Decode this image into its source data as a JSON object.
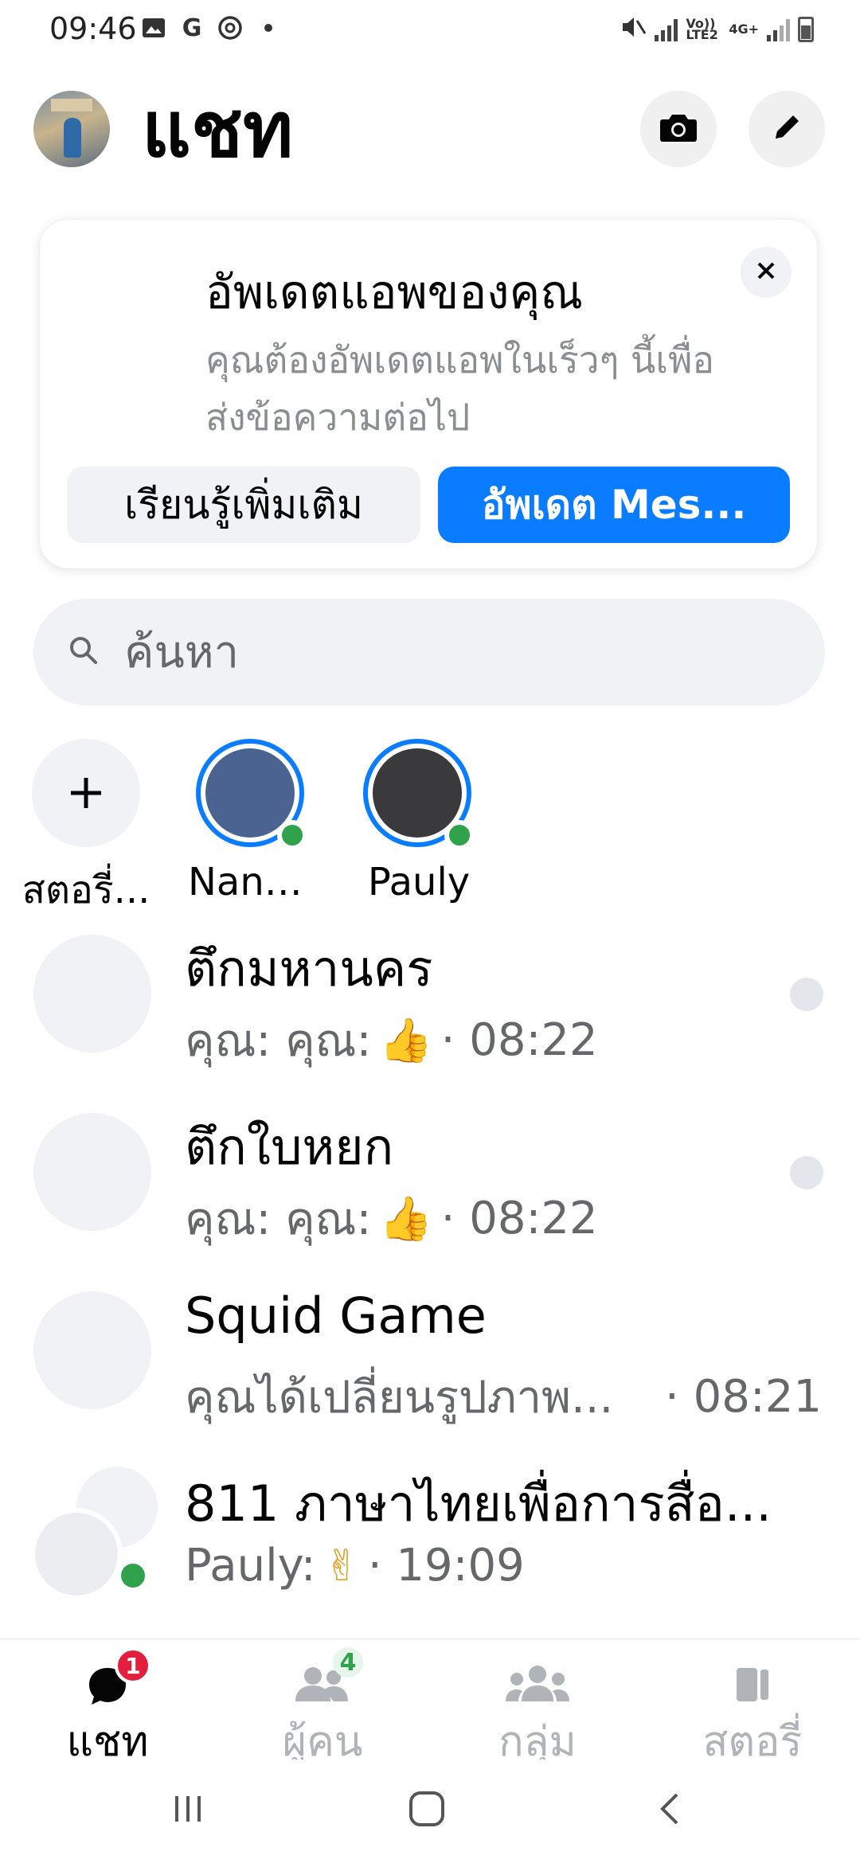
{
  "status_bar": {
    "time": "09:46",
    "left_icons": [
      "image-icon",
      "google-icon",
      "threads-icon",
      "dot-icon"
    ],
    "network_label_1": "Vo)) LTE2",
    "network_label_2": "4G+"
  },
  "header": {
    "title": "แชท",
    "camera_icon": "camera-icon",
    "compose_icon": "pencil-icon"
  },
  "update_card": {
    "title": "อัพเดตแอพของคุณ",
    "description": "คุณต้องอัพเดตแอพในเร็วๆ นี้เพื่อส่งข้อความต่อไป",
    "learn_more_label": "เรียนรู้เพิ่มเติม",
    "update_label": "อัพเดต Mes...",
    "close_icon": "close-icon"
  },
  "search": {
    "placeholder": "ค้นหา"
  },
  "stories": {
    "add_label": "สตอรี่...",
    "items": [
      {
        "name": "Nanti...",
        "color": "#4a6391",
        "online": true
      },
      {
        "name": "Pauly",
        "color": "#3a393c",
        "online": true
      }
    ]
  },
  "chats": [
    {
      "name": "ตึกมหานคร",
      "preview": "คุณ: คุณ:",
      "emoji": "👍",
      "time": "· 08:22",
      "read": true
    },
    {
      "name": "ตึกใบหยก",
      "preview": "คุณ: คุณ:",
      "emoji": "👍",
      "time": "· 08:22",
      "read": true
    },
    {
      "name": "Squid Game",
      "preview": "คุณได้เปลี่ยนรูปภาพ...",
      "emoji": "",
      "time": "· 08:21",
      "read": false
    },
    {
      "name": "811 ภาษาไทยเพื่อการสื่อ...",
      "preview": "Pauly:",
      "emoji": "✌",
      "time": "· 19:09",
      "read": false
    }
  ],
  "bottom_nav": [
    {
      "label": "แชท",
      "icon": "chat-bubble-icon",
      "badge": "1",
      "active": true
    },
    {
      "label": "ผู้คน",
      "icon": "people-icon",
      "badge": "4",
      "active": false
    },
    {
      "label": "กลุ่ม",
      "icon": "groups-icon",
      "badge": "",
      "active": false
    },
    {
      "label": "สตอรี่",
      "icon": "stories-icon",
      "badge": "",
      "active": false
    }
  ],
  "colors": {
    "accent": "#0a7cff",
    "online": "#31a24c",
    "badge": "#e41e3f"
  }
}
